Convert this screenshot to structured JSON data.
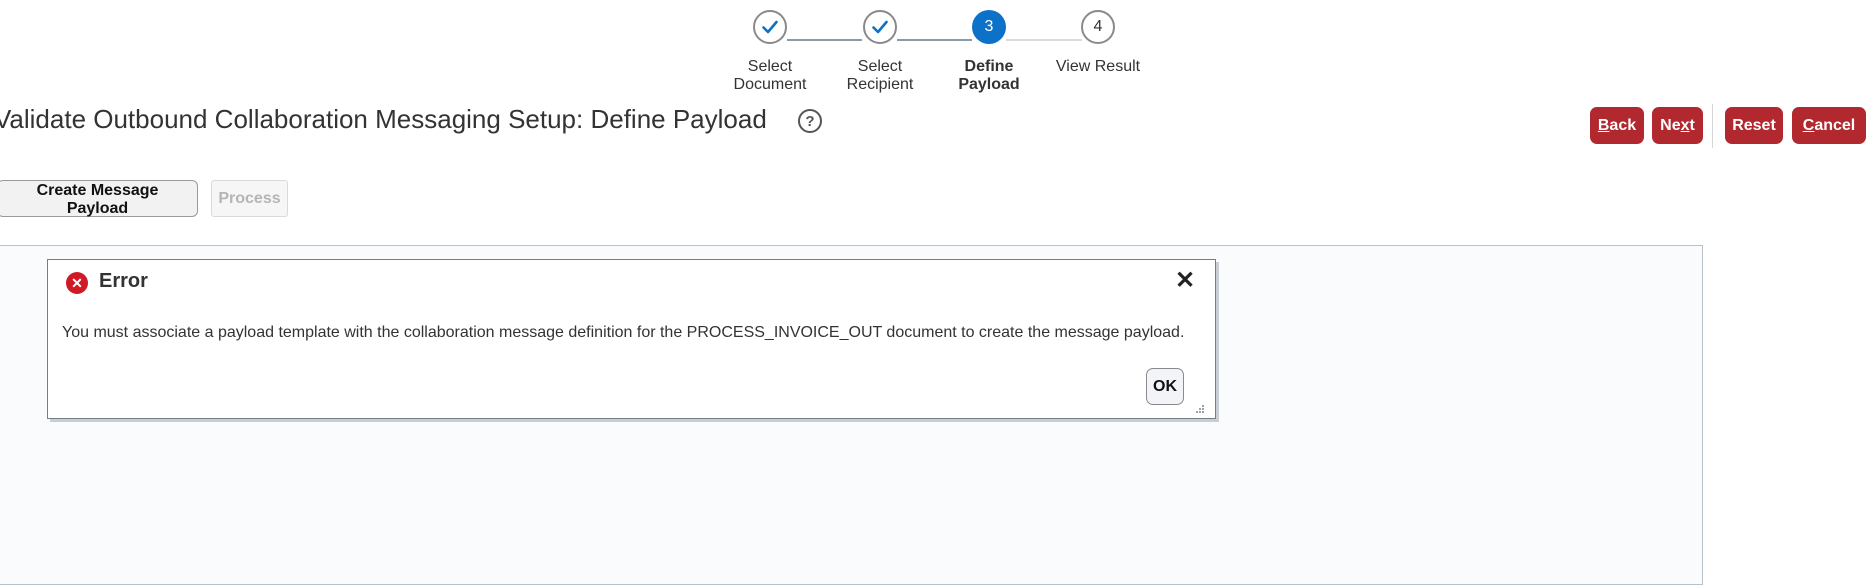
{
  "train": {
    "stops": [
      {
        "label_line1": "Select",
        "label_line2": "Document",
        "state": "done",
        "icon": "check-icon"
      },
      {
        "label_line1": "Select",
        "label_line2": "Recipient",
        "state": "done",
        "icon": "check-icon"
      },
      {
        "number": "3",
        "label_line1": "Define",
        "label_line2": "Payload",
        "state": "current"
      },
      {
        "number": "4",
        "label_line1": "View Result",
        "label_line2": "",
        "state": "todo"
      }
    ]
  },
  "page": {
    "title": "Validate Outbound Collaboration Messaging Setup: Define Payload",
    "help_icon": "question-circle-icon"
  },
  "actions": {
    "back_first": "B",
    "back_rest": "ack",
    "next_first": "Ne",
    "next_u": "x",
    "next_rest": "t",
    "reset": "Reset",
    "cancel_first": "C",
    "cancel_rest": "ancel"
  },
  "toolbar": {
    "create_payload": "Create Message Payload",
    "process": "Process"
  },
  "dialog": {
    "title": "Error",
    "message": "You must associate a payload template with the collaboration message definition for the PROCESS_INVOICE_OUT document to create the message payload.",
    "ok": "OK",
    "close_glyph": "✕"
  },
  "colors": {
    "accent": "#0c71c9",
    "action_red": "#b1282e",
    "error_red": "#cf1a25"
  }
}
